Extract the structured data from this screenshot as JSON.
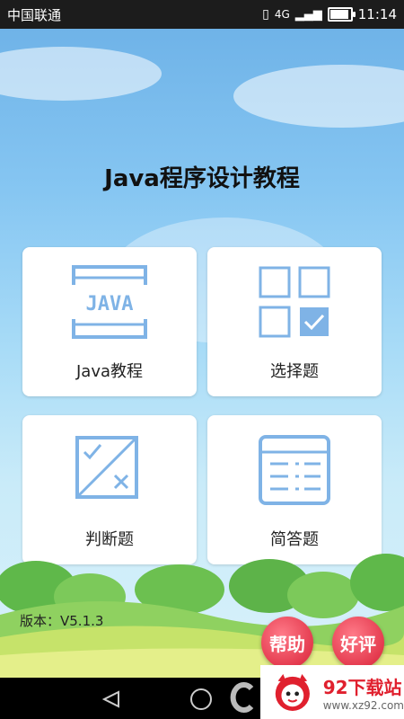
{
  "status_bar": {
    "carrier": "中国联通",
    "network": "4G",
    "time": "11:14",
    "battery_level": 0.85
  },
  "app": {
    "title": "Java程序设计教程",
    "cards": [
      {
        "label": "Java教程",
        "icon": "java-book-icon"
      },
      {
        "label": "选择题",
        "icon": "choice-grid-icon"
      },
      {
        "label": "判断题",
        "icon": "true-false-icon"
      },
      {
        "label": "简答题",
        "icon": "list-lines-icon"
      }
    ],
    "java_icon_text": "JAVA",
    "version": "版本：V5.1.3",
    "help_button": "帮助",
    "rate_button": "好评"
  },
  "watermark": {
    "brand": "92下载站",
    "url": "www.xz92.com"
  },
  "colors": {
    "icon_blue": "#7fb3e6",
    "button_red": "#e43a4e"
  }
}
